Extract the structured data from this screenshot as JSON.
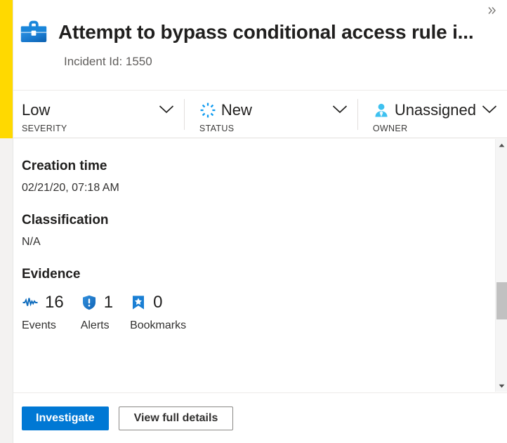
{
  "header": {
    "icon": "briefcase-icon",
    "title": "Attempt to bypass conditional access rule i...",
    "incident_id_label": "Incident Id: 1550",
    "collapse_icon": "double-chevron-right-icon"
  },
  "meta": {
    "severity": {
      "value": "Low",
      "label": "SEVERITY",
      "bar_color": "#ffd900",
      "chevron": "chevron-down-icon"
    },
    "status": {
      "value": "New",
      "label": "STATUS",
      "icon": "status-new-spinner-icon",
      "icon_color": "#0f9bf0",
      "chevron": "chevron-down-icon"
    },
    "owner": {
      "value": "Unassigned",
      "label": "OWNER",
      "icon": "person-icon",
      "icon_color": "#3ec1f0",
      "chevron": "chevron-down-icon"
    }
  },
  "detail": {
    "fields": [
      {
        "label": "Creation time",
        "value": "02/21/20, 07:18 AM"
      },
      {
        "label": "Classification",
        "value": "N/A"
      }
    ],
    "evidence": {
      "label": "Evidence",
      "items": [
        {
          "count": "16",
          "name": "Events",
          "icon": "pulse-waveform-icon",
          "icon_color": "#0f6cbd"
        },
        {
          "count": "1",
          "name": "Alerts",
          "icon": "shield-alert-icon",
          "icon_color": "#1a7fd4"
        },
        {
          "count": "0",
          "name": "Bookmarks",
          "icon": "bookmark-star-icon",
          "icon_color": "#1a7fd4"
        }
      ]
    }
  },
  "scrollbar": {
    "up_icon": "scroll-up-arrow-icon",
    "down_icon": "scroll-down-arrow-icon"
  },
  "footer": {
    "investigate_label": "Investigate",
    "view_details_label": "View full details",
    "primary_color": "#0078d4"
  }
}
